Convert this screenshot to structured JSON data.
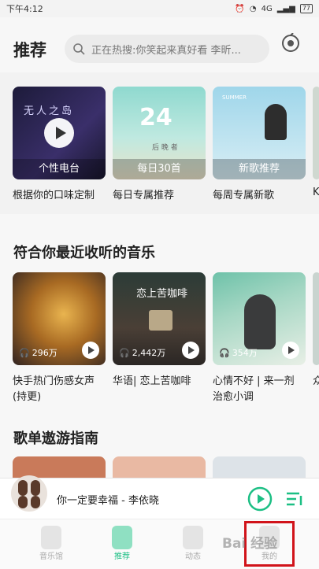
{
  "status_bar": {
    "time": "下午4:12",
    "battery": "77",
    "net": "4G"
  },
  "header": {
    "title": "推荐",
    "search_placeholder": "正在热搜:你笑起来真好看 李昕..."
  },
  "cards": [
    {
      "label": "个性电台",
      "caption": "根据你的口味定制",
      "art_text": "无人之岛"
    },
    {
      "label": "每日30首",
      "caption": "每日专属推荐",
      "art_text": "24",
      "art_sub": "后 晚 者"
    },
    {
      "label": "新歌推荐",
      "caption": "每周专属新歌",
      "art_text": "SUMMER"
    },
    {
      "caption": "K"
    }
  ],
  "section2": {
    "title": "符合你最近收听的音乐",
    "items": [
      {
        "count": "296万",
        "caption_line1": "快手热门伤感女声",
        "caption_line2": "(持更)"
      },
      {
        "count": "2,442万",
        "art_text": "恋上苦咖啡",
        "caption_line1": "华语| 恋上苦咖啡",
        "caption_line2": ""
      },
      {
        "count": "354万",
        "caption_line1": "心情不好 | 来一剂",
        "caption_line2": "治愈小调"
      },
      {
        "caption_line1": "众"
      }
    ]
  },
  "section3": {
    "title": "歌单遨游指南"
  },
  "player": {
    "song": "你一定要幸福 - 李依晓"
  },
  "tabs": [
    {
      "label": "音乐馆"
    },
    {
      "label": "推荐"
    },
    {
      "label": "动态"
    },
    {
      "label": "我的"
    }
  ],
  "watermark": "Bai 经验"
}
